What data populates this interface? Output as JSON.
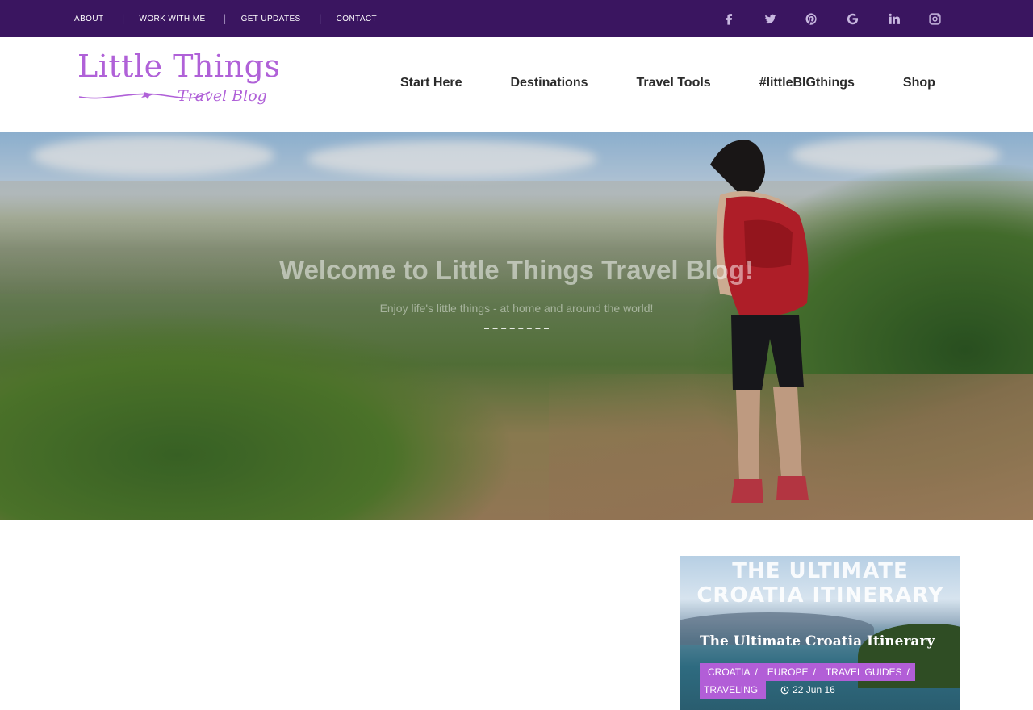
{
  "topbar": {
    "links": [
      {
        "label": "ABOUT"
      },
      {
        "label": "WORK WITH ME"
      },
      {
        "label": "GET UPDATES"
      },
      {
        "label": "CONTACT"
      }
    ],
    "social_icons": [
      "facebook-icon",
      "twitter-icon",
      "pinterest-icon",
      "google-icon",
      "linkedin-icon",
      "instagram-icon"
    ],
    "background": "#3a1560"
  },
  "header": {
    "logo": {
      "title": "Little Things",
      "subtitle": "Travel Blog"
    },
    "nav": [
      {
        "label": "Start Here"
      },
      {
        "label": "Destinations"
      },
      {
        "label": "Travel Tools"
      },
      {
        "label": "#littleBIGthings"
      },
      {
        "label": "Shop"
      }
    ]
  },
  "hero": {
    "title": "Welcome to Little Things Travel Blog!",
    "subtitle": "Enjoy life's little things - at home and around the world!"
  },
  "post": {
    "image_text_line1": "THE ULTIMATE",
    "image_text_line2": "CROATIA ITINERARY",
    "title": "The Ultimate Croatia Itinerary",
    "categories": [
      "CROATIA",
      "EUROPE",
      "TRAVEL GUIDES",
      "TRAVELING"
    ],
    "date": "22 Jun 16",
    "accent": "#b25ed7"
  }
}
